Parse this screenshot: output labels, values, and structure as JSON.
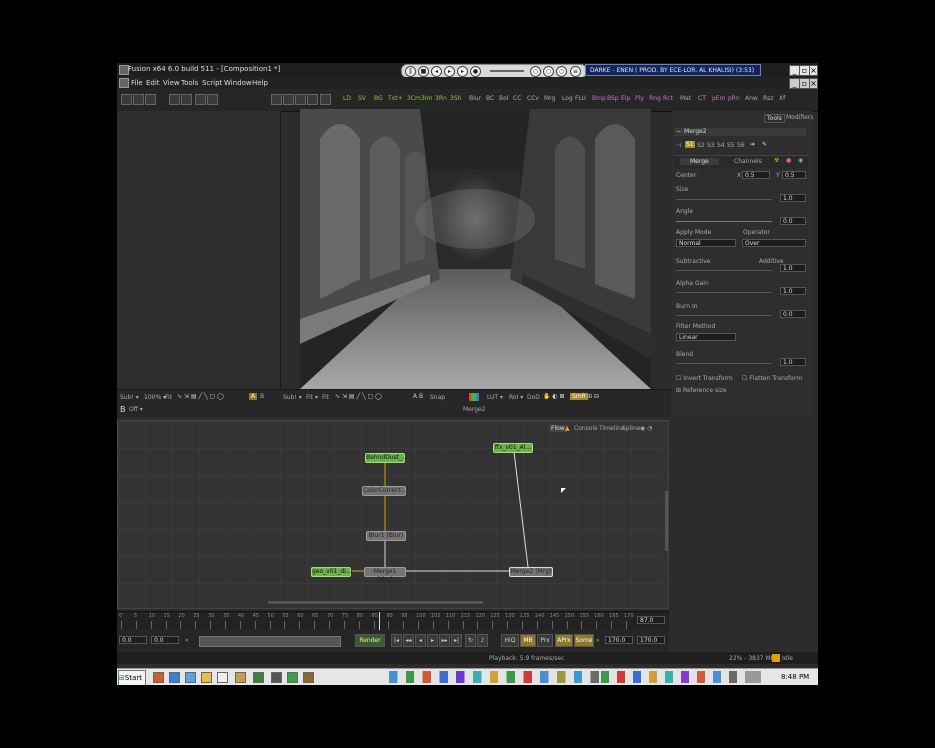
{
  "window": {
    "title": "Fusion x64 6.0 build 511 - [Composition1 *]",
    "menu": [
      "File",
      "Edit",
      "View",
      "Tools",
      "Script",
      "Window",
      "Help"
    ],
    "track_display": "DARKE - ENEN ( PROD. BY ECE-LOR. AL KHALISI) (3:53)"
  },
  "toolbar": {
    "tool_buttons": [
      "LD",
      "SV",
      "BG",
      "Txt+",
      "3Cm",
      "3Im",
      "3Rn",
      "3Sh",
      "Blur",
      "BC",
      "Bol",
      "CC",
      "CCv",
      "Mrg",
      "Log",
      "FLU",
      "Bmp",
      "BSp",
      "Elp",
      "Ply",
      "Rng",
      "Rct",
      "Mat",
      "CT",
      "pEm",
      "pRn",
      "Anw",
      "Rsz",
      "Xf"
    ],
    "tool_colors": {
      "green": "#8bc44a",
      "purple": "#c276c6",
      "default": "#aaaaaa"
    }
  },
  "viewer_strip": {
    "left_zoom": "Sub! ▾",
    "left_zoom_pct": "100% ▾",
    "left_fit": "Fit",
    "left_b": "B",
    "left_off": "Off ▾",
    "right_sub": "Sub! ▾",
    "right_fit": "Fit ▾",
    "right_fit2": "Fit",
    "right_snap": "Snap",
    "right_lut": "LUT ▾",
    "right_roi": "RoI ▾",
    "right_dod": "DoD",
    "right_smr": "SmR",
    "viewer_caption": "Merge2"
  },
  "inspector": {
    "tabs": [
      "Tools",
      "Modifiers"
    ],
    "node_title": "Merge2",
    "channel_buttons": [
      "S1",
      "S2",
      "S3",
      "S4",
      "S5",
      "S6"
    ],
    "subtabs": [
      "Merge",
      "Channels"
    ],
    "center_label": "Center",
    "center_x_label": "X",
    "center_x": "0.5",
    "center_y_label": "Y",
    "center_y": "0.5",
    "size_label": "Size",
    "size_value": "1.0",
    "angle_label": "Angle",
    "angle_value": "0.0",
    "apply_mode_label": "Apply Mode",
    "apply_mode": "Normal",
    "operator_label": "Operator",
    "operator": "Over",
    "subtractive_label": "Subtractive",
    "additive_label": "Additive",
    "additive_value": "1.0",
    "alpha_gain_label": "Alpha Gain",
    "alpha_gain_value": "1.0",
    "burn_in_label": "Burn In",
    "burn_in_value": "0.0",
    "filter_method_label": "Filter Method",
    "filter_method": "Linear",
    "blend_label": "Blend",
    "blend_value": "1.0",
    "invert_transform": "Invert Transform",
    "flatten_transform": "Flatten Transform",
    "reference_size": "Reference size"
  },
  "flow": {
    "tabs": [
      "Flow",
      "Console",
      "Timeline",
      "Spline"
    ],
    "nodes": {
      "behind_dust": "BehndDust_...",
      "color_correct": "ColorCorrect...",
      "blur": "Blur1 (Blur)",
      "merge1": "Merge1 (Mrg)",
      "merge2": "Merge2 (Mrg)",
      "geo": "geo_v01_di...",
      "ffx": "ffx_v01_Al..."
    }
  },
  "timeline": {
    "ticks": [
      "0",
      "5",
      "10",
      "15",
      "20",
      "25",
      "30",
      "35",
      "40",
      "45",
      "50",
      "55",
      "60",
      "65",
      "70",
      "75",
      "80",
      "85",
      "90",
      "95",
      "100",
      "105",
      "110",
      "115",
      "120",
      "125",
      "130",
      "135",
      "140",
      "145",
      "150",
      "155",
      "160",
      "165",
      "170"
    ],
    "current_frame": "87.0"
  },
  "controls": {
    "start": "0.0",
    "render_start": "0.0",
    "render_btn": "Render",
    "hiq": "HiQ",
    "mb": "MB",
    "prx": "Prx",
    "aprx": "APrx",
    "some": "Some",
    "end": "170.0",
    "render_end": "170.0"
  },
  "status": {
    "playback": "Playback: 5.9 frames/sec",
    "memory": "22% - 3837 MB",
    "state": "Idle"
  },
  "taskbar": {
    "start": "Start",
    "time": "8:48 PM"
  }
}
